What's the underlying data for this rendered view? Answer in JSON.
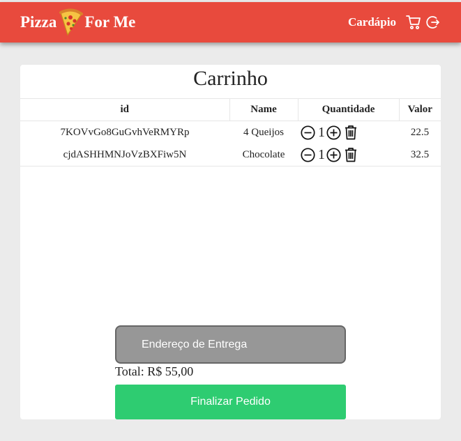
{
  "brand": {
    "name_part1": "Pizza",
    "name_part2": "For Me"
  },
  "nav": {
    "menu_label": "Cardápio",
    "cart_icon": "cart-icon",
    "logout_icon": "logout-icon"
  },
  "cart": {
    "title": "Carrinho",
    "columns": [
      "id",
      "Name",
      "Quantidade",
      "Valor"
    ],
    "rows": [
      {
        "id": "7KOVvGo8GuGvhVeRMYRp",
        "name": "4 Queijos",
        "quantity": "1",
        "value": "22.5"
      },
      {
        "id": "cjdASHHMNJoVzBXFiw5N",
        "name": "Chocolate",
        "quantity": "1",
        "value": "32.5"
      }
    ],
    "address_placeholder": "Endereço de Entrega",
    "total": "Total: R$ 55,00",
    "finish_label": "Finalizar Pedido"
  },
  "colors": {
    "header": "#e84a3d",
    "finish_button": "#2ecc71",
    "address_field": "#979797"
  }
}
